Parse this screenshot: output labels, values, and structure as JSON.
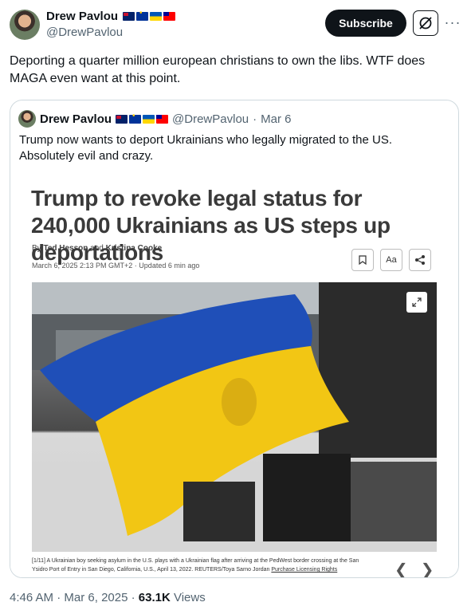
{
  "author": {
    "name": "Drew Pavlou",
    "handle": "@DrewPavlou",
    "flags": [
      "australia-flag",
      "eu-flag",
      "ukraine-flag",
      "taiwan-flag"
    ]
  },
  "actions": {
    "subscribe_label": "Subscribe",
    "grok_icon": "grok-icon",
    "more_icon": "more-icon"
  },
  "tweet": {
    "text": "Deporting a quarter million european christians to own the libs. WTF does MAGA even want at this point."
  },
  "quoted": {
    "name": "Drew Pavlou",
    "handle": "@DrewPavlou",
    "separator": "·",
    "date": "Mar 6",
    "text": "Trump now wants to deport Ukrainians who legally migrated to the US. Absolutely evil and crazy.",
    "article": {
      "headline": "Trump to revoke legal status for 240,000 Ukrainians as US steps up deportations",
      "by": "By",
      "author1": "Ted Hesson",
      "and": "and",
      "author2": "Kristina Cooke",
      "dateline": "March 6, 2025 2:13 PM GMT+2 · Updated 6 min ago",
      "text_size_label": "Aa",
      "caption": "[1/11] A Ukrainian boy seeking asylum in the U.S. plays with a Ukrainian flag after arriving at the PedWest border crossing at the San Ysidro Port of Entry in San Diego, California, U.S., April 13, 2022. REUTERS/Toya Sarno Jordan",
      "caption_link": "Purchase Licensing Rights"
    }
  },
  "footer": {
    "time": "4:46 AM",
    "dot": "·",
    "date": "Mar 6, 2025",
    "views_count": "63.1K",
    "views_label": "Views"
  },
  "colors": {
    "text": "#0f1419",
    "muted": "#536471",
    "border": "#cfd9de",
    "ukraine_blue": "#0057b7",
    "ukraine_yellow": "#ffd700"
  }
}
